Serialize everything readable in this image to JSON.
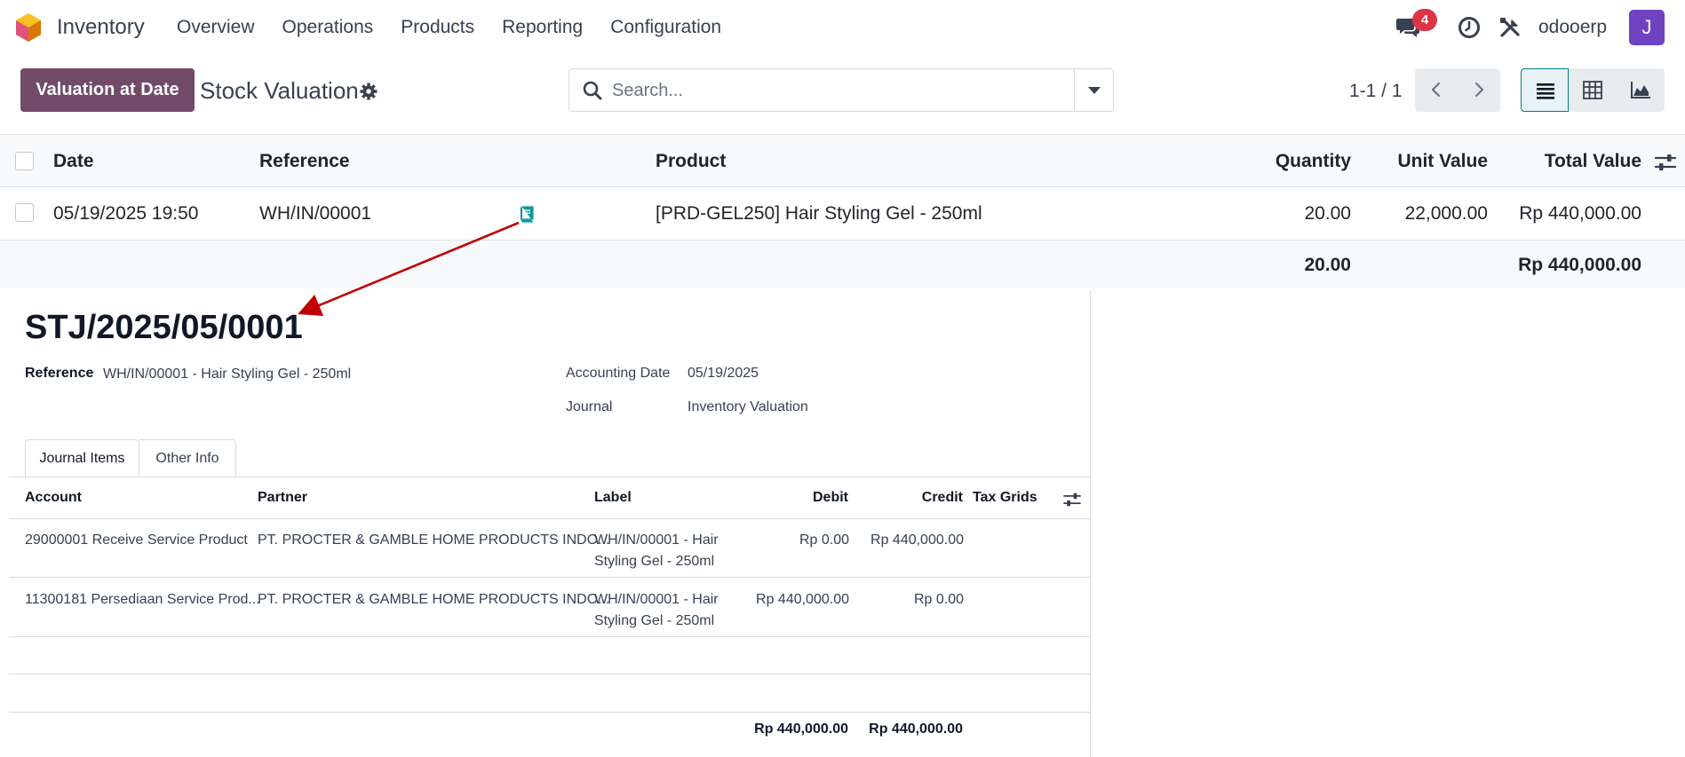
{
  "navbar": {
    "app_name": "Inventory",
    "menu": [
      "Overview",
      "Operations",
      "Products",
      "Reporting",
      "Configuration"
    ],
    "chat_badge": "4",
    "db_name": "odooerp",
    "avatar_initial": "J",
    "icons": [
      "app-logo-icon",
      "chat-icon",
      "clock-icon",
      "tools-icon"
    ]
  },
  "control_panel": {
    "primary_button": "Valuation at Date",
    "title": "Stock Valuation",
    "search_placeholder": "Search...",
    "pager": "1-1 / 1",
    "views": [
      "list-view-icon",
      "pivot-view-icon",
      "graph-view-icon"
    ]
  },
  "list": {
    "columns": [
      "Date",
      "Reference",
      "Product",
      "Quantity",
      "Unit Value",
      "Total Value"
    ],
    "rows": [
      {
        "date": "05/19/2025 19:50",
        "reference": "WH/IN/00001",
        "product": "[PRD-GEL250] Hair Styling Gel - 250ml",
        "quantity": "20.00",
        "unit_value": "22,000.00",
        "total_value": "Rp 440,000.00"
      }
    ],
    "totals": {
      "quantity": "20.00",
      "total_value": "Rp 440,000.00"
    }
  },
  "journal_entry": {
    "name": "STJ/2025/05/0001",
    "reference_label": "Reference",
    "reference_value": "WH/IN/00001 - Hair Styling Gel - 250ml",
    "accounting_date_label": "Accounting Date",
    "accounting_date_value": "05/19/2025",
    "journal_label": "Journal",
    "journal_value": "Inventory Valuation",
    "tabs": [
      "Journal Items",
      "Other Info"
    ],
    "columns": [
      "Account",
      "Partner",
      "Label",
      "Debit",
      "Credit",
      "Tax Grids"
    ],
    "items": [
      {
        "account": "29000001 Receive Service Product",
        "partner": "PT. PROCTER & GAMBLE HOME PRODUCTS INDO...",
        "label_line1": "WH/IN/00001 - Hair",
        "label_line2": "Styling Gel - 250ml",
        "debit": "Rp 0.00",
        "credit": "Rp 440,000.00"
      },
      {
        "account": "11300181 Persediaan Service Prod...",
        "partner": "PT. PROCTER & GAMBLE HOME PRODUCTS INDO...",
        "label_line1": "WH/IN/00001 - Hair",
        "label_line2": "Styling Gel - 250ml",
        "debit": "Rp 440,000.00",
        "credit": "Rp 0.00"
      }
    ],
    "total_debit": "Rp 440,000.00",
    "total_credit": "Rp 440,000.00"
  },
  "colors": {
    "primary": "#714b67",
    "accent": "#017e84",
    "badge": "#dc3545",
    "avatar": "#6f42c1",
    "annotation_arrow": "#c00000"
  }
}
